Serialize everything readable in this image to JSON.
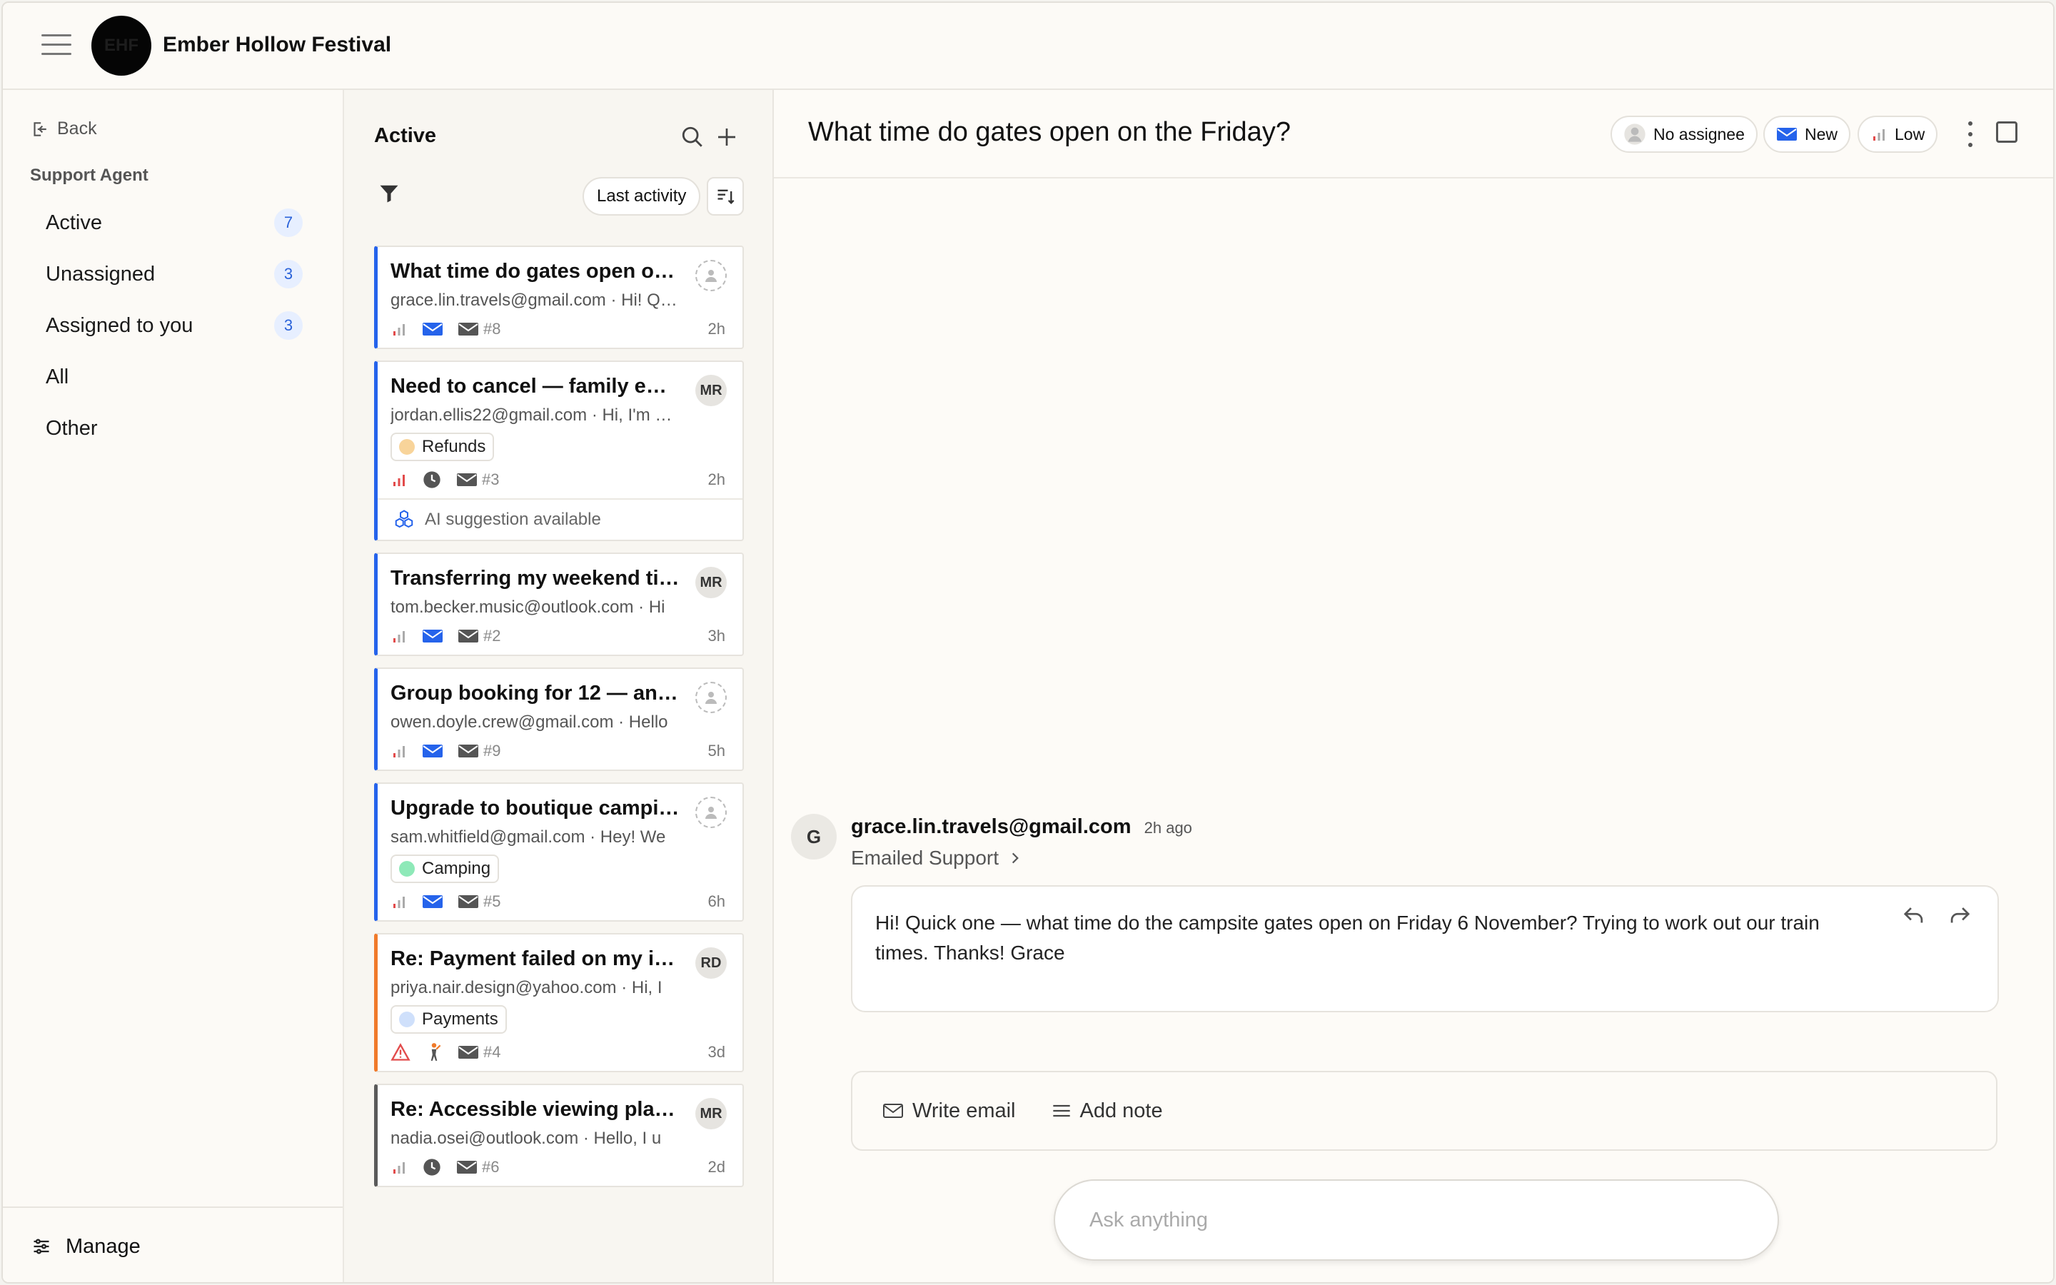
{
  "app": {
    "logo_text": "EHF",
    "title": "Ember Hollow Festival"
  },
  "sidebar": {
    "back_label": "Back",
    "section_label": "Support Agent",
    "items": [
      {
        "label": "Active",
        "count": "7"
      },
      {
        "label": "Unassigned",
        "count": "3"
      },
      {
        "label": "Assigned to you",
        "count": "3"
      },
      {
        "label": "All",
        "count": ""
      },
      {
        "label": "Other",
        "count": ""
      }
    ],
    "manage_label": "Manage"
  },
  "list": {
    "title": "Active",
    "sort_label": "Last activity",
    "cards": [
      {
        "subject": "What time do gates open on the Friday?",
        "preview": "grace.lin.travels@gmail.com · Hi! Quick one",
        "assignee": "",
        "tag": "",
        "tag_color": "",
        "ticket": "#8",
        "time": "2h"
      },
      {
        "subject": "Need to cancel — family emergency",
        "preview": "jordan.ellis22@gmail.com · Hi, I'm sorry",
        "assignee": "MR",
        "tag": "Refunds",
        "tag_color": "#f8d49a",
        "ticket": "#3",
        "time": "2h",
        "ai": "AI suggestion available"
      },
      {
        "subject": "Transferring my weekend ticket",
        "preview": "tom.becker.music@outlook.com · Hi",
        "assignee": "MR",
        "tag": "",
        "tag_color": "",
        "ticket": "#2",
        "time": "3h"
      },
      {
        "subject": "Group booking for 12 — any discount?",
        "preview": "owen.doyle.crew@gmail.com · Hello",
        "assignee": "",
        "tag": "",
        "tag_color": "",
        "ticket": "#9",
        "time": "5h"
      },
      {
        "subject": "Upgrade to boutique camping",
        "preview": "sam.whitfield@gmail.com · Hey! We",
        "assignee": "",
        "tag": "Camping",
        "tag_color": "#8ee9b8",
        "ticket": "#5",
        "time": "6h"
      },
      {
        "subject": "Re: Payment failed on my instalment",
        "preview": "priya.nair.design@yahoo.com · Hi, I",
        "assignee": "RD",
        "tag": "Payments",
        "tag_color": "#cfe0fb",
        "ticket": "#4",
        "time": "3d"
      },
      {
        "subject": "Re: Accessible viewing platform",
        "preview": "nadia.osei@outlook.com · Hello, I u",
        "assignee": "MR",
        "tag": "",
        "tag_color": "",
        "ticket": "#6",
        "time": "2d"
      }
    ]
  },
  "conversation": {
    "title": "What time do gates open on the Friday?",
    "assignee_pill": "No assignee",
    "status_pill": "New",
    "priority_pill": "Low",
    "message": {
      "avatar": "G",
      "from": "grace.lin.travels@gmail.com",
      "ago": "2h ago",
      "channel": "Emailed Support",
      "body": "Hi! Quick one — what time do the campsite gates open on Friday 6 November? Trying to work out our train times. Thanks! Grace"
    },
    "composer": {
      "write_email": "Write email",
      "add_note": "Add note"
    },
    "ask_placeholder": "Ask anything"
  },
  "colors": {
    "accent": "#2563eb",
    "priority_red": "#e24b4b",
    "urgent_orange": "#f07a2a"
  }
}
